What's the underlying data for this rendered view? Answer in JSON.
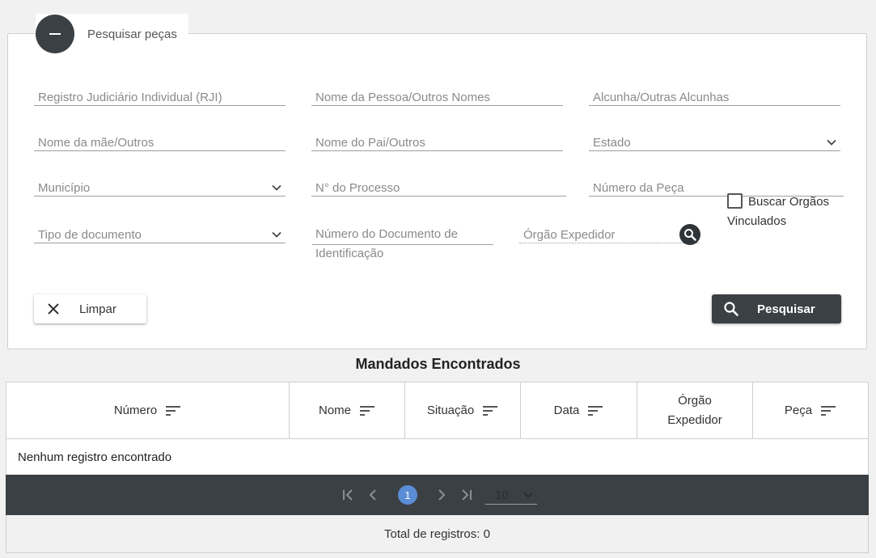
{
  "search_panel": {
    "title": "Pesquisar peças",
    "fields": {
      "rji": "Registro Judiciário Individual (RJI)",
      "nome": "Nome da Pessoa/Outros Nomes",
      "alcunha": "Alcunha/Outras Alcunhas",
      "mae": "Nome da mãe/Outros",
      "pai": "Nome do Pai/Outros",
      "estado": "Estado",
      "municipio": "Município",
      "processo": "N° do Processo",
      "numero_peca": "Número da Peça",
      "tipo_documento": "Tipo de documento",
      "numero_documento": "Número do Documento de Identificação",
      "orgao_expedidor": "Órgão Expedidor"
    },
    "checkbox_label": "Buscar Orgãos Vinculados",
    "clear_label": "Limpar",
    "search_label": "Pesquisar"
  },
  "results": {
    "title": "Mandados Encontrados",
    "columns": [
      "Número",
      "Nome",
      "Situação",
      "Data",
      "Órgão Expedidor",
      "Peça"
    ],
    "empty_message": "Nenhum registro encontrado",
    "current_page": "1",
    "page_size": "10",
    "total_label": "Total de registros: 0"
  },
  "colors": {
    "dark": "#3b4045",
    "page_active": "#5b8dd6"
  }
}
